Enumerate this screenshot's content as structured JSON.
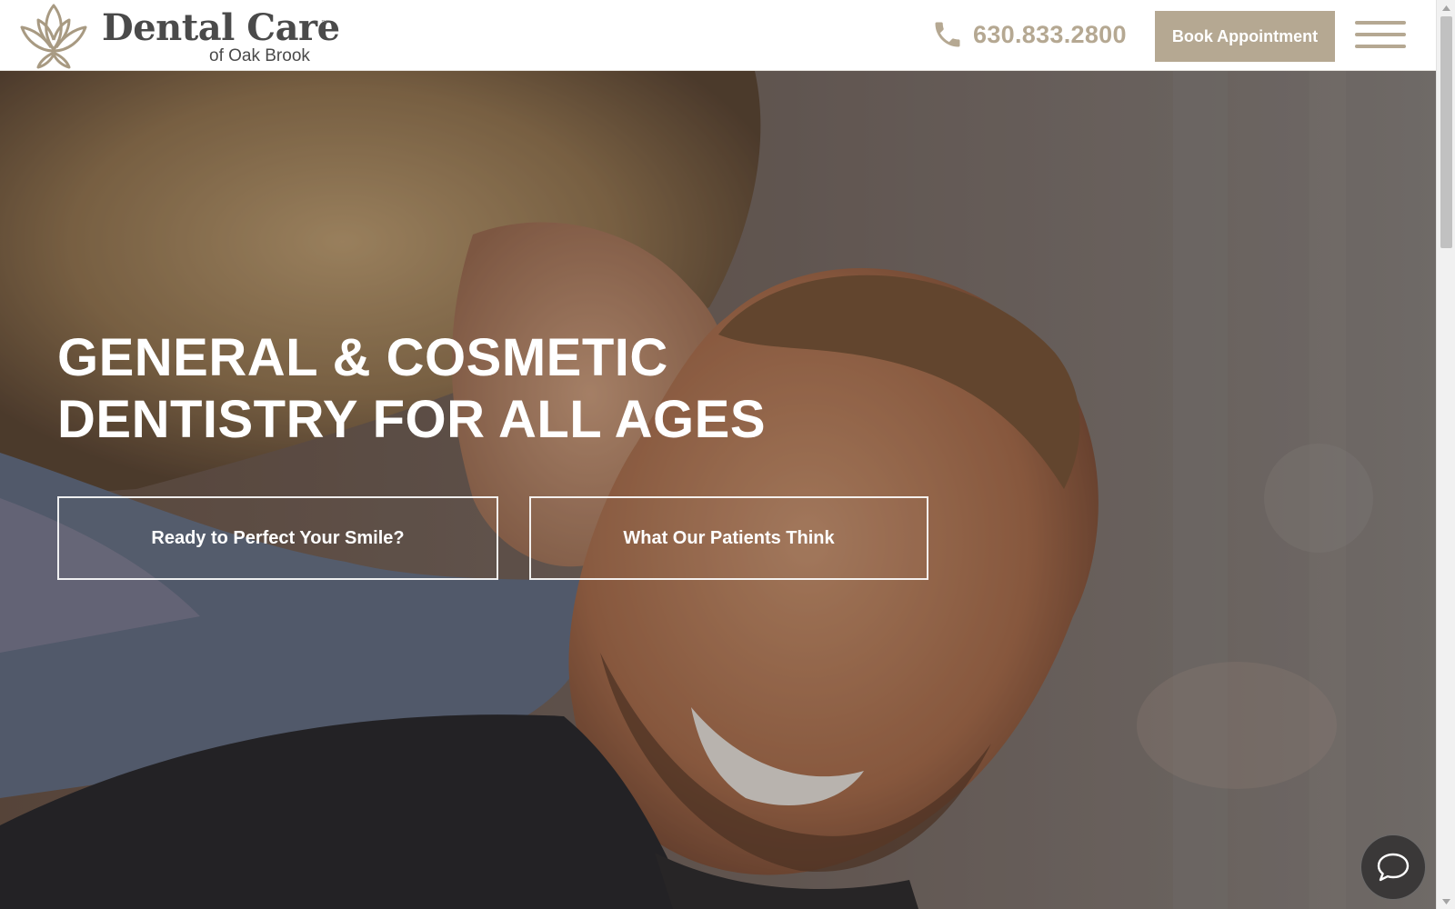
{
  "brand": {
    "name": "Dental Care",
    "trademark": "™",
    "location": "of Oak Brook",
    "color": "#b5a892",
    "icon": "lotus-logo-icon"
  },
  "header": {
    "phone": {
      "number": "630.833.2800",
      "icon": "phone-icon"
    },
    "book_button_label": "Book Appointment",
    "menu_icon": "hamburger-menu-icon"
  },
  "hero": {
    "heading_line1": "GENERAL & COSMETIC",
    "heading_line2": "DENTISTRY FOR ALL AGES",
    "cta_primary": "Ready to Perfect Your Smile?",
    "cta_secondary": "What Our Patients Think"
  },
  "chat": {
    "icon": "chat-bubble-icon"
  }
}
